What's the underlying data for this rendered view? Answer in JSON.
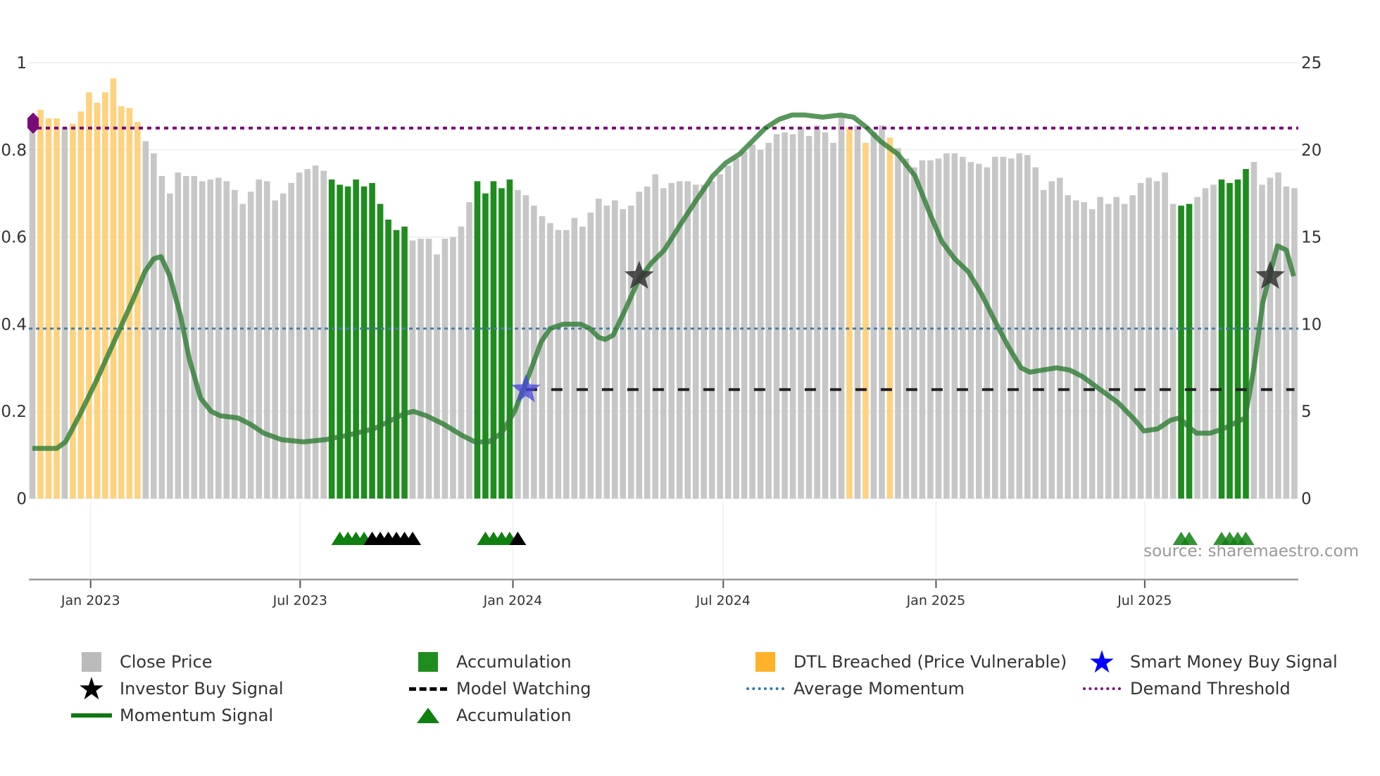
{
  "chart_data": {
    "type": "bar",
    "x_unit": "week index",
    "left_axis": {
      "ylim": [
        0,
        1
      ],
      "ticks": [
        "0",
        "0.2",
        "0.4",
        "0.6",
        "0.8",
        "1"
      ],
      "tick_values": [
        0,
        0.2,
        0.4,
        0.6,
        0.8,
        1
      ]
    },
    "right_axis": {
      "ylim": [
        0,
        25
      ],
      "ticks": [
        "0",
        "5",
        "10",
        "15",
        "20",
        "25"
      ],
      "tick_values": [
        0,
        5,
        10,
        15,
        20,
        25
      ]
    },
    "x_ticks": [
      {
        "label": "Jan 2023",
        "week": 7.2
      },
      {
        "label": "Jul 2023",
        "week": 33.1
      },
      {
        "label": "Jan 2024",
        "week": 59.4
      },
      {
        "label": "Jul 2024",
        "week": 85.4
      },
      {
        "label": "Jan 2025",
        "week": 111.7
      },
      {
        "label": "Jul 2025",
        "week": 137.5
      }
    ],
    "close_price": [
      21.2,
      22.3,
      21.8,
      21.8,
      21.3,
      21.5,
      22.2,
      23.3,
      22.7,
      23.3,
      24.1,
      22.5,
      22.4,
      21.6,
      20.5,
      19.8,
      18.5,
      17.5,
      18.7,
      18.5,
      18.5,
      18.2,
      18.3,
      18.4,
      18.2,
      17.7,
      16.9,
      17.6,
      18.3,
      18.2,
      17.1,
      17.5,
      18.1,
      18.7,
      18.9,
      19.1,
      18.8,
      18.3,
      18.0,
      17.9,
      18.3,
      17.9,
      18.1,
      16.9,
      16.0,
      15.4,
      15.6,
      14.8,
      14.9,
      14.9,
      14.0,
      14.9,
      15.0,
      15.6,
      17.0,
      18.2,
      17.5,
      18.2,
      17.8,
      18.3,
      17.7,
      17.4,
      16.8,
      16.2,
      15.8,
      15.4,
      15.4,
      16.1,
      15.6,
      16.4,
      17.2,
      16.8,
      17.1,
      16.6,
      16.8,
      17.6,
      17.9,
      18.6,
      17.8,
      18.1,
      18.2,
      18.2,
      18.0,
      18.0,
      18.2,
      18.6,
      19.1,
      19.5,
      19.9,
      20.3,
      20.0,
      20.4,
      20.9,
      21.0,
      20.9,
      21.3,
      20.8,
      21.4,
      21.0,
      20.4,
      21.9,
      21.3,
      21.4,
      20.4,
      21.0,
      21.4,
      20.7,
      20.1,
      19.5,
      19.0,
      19.4,
      19.4,
      19.5,
      19.8,
      19.8,
      19.6,
      19.3,
      19.2,
      19.0,
      19.6,
      19.6,
      19.5,
      19.8,
      19.7,
      19.0,
      17.7,
      18.2,
      18.4,
      17.4,
      17.1,
      17.0,
      16.6,
      17.3,
      16.9,
      17.3,
      16.9,
      17.4,
      18.1,
      18.4,
      18.2,
      18.7,
      16.9,
      16.8,
      16.9,
      17.3,
      17.8,
      18.0,
      18.3,
      18.1,
      18.3,
      18.9,
      19.3,
      18.0,
      18.4,
      18.7,
      17.9,
      17.8
    ],
    "bar_state": "GOOOGOOOOOOOOOGGGGGGGGGGGGGGGGGGGGGGGAAAAAAAAAAGGGGGGGGAAAAAGGGGGGGGGGGGGGGGGGGGGGGGGGGGGGGGGGGGGGGGGOGOGGOGGGGGGGGGGGGGGGGGGGGGGGGGGGGGGGGGGGAAGGGAAAAGGGGGGG",
    "momentum_signal": [
      [
        0,
        0.115
      ],
      [
        3,
        0.115
      ],
      [
        4.1,
        0.13
      ],
      [
        5.8,
        0.19
      ],
      [
        7.9,
        0.27
      ],
      [
        10.1,
        0.36
      ],
      [
        12.3,
        0.45
      ],
      [
        13.9,
        0.52
      ],
      [
        15,
        0.55
      ],
      [
        15.9,
        0.555
      ],
      [
        17,
        0.51
      ],
      [
        18.3,
        0.42
      ],
      [
        19.4,
        0.32
      ],
      [
        20.8,
        0.23
      ],
      [
        22.1,
        0.2
      ],
      [
        23.2,
        0.19
      ],
      [
        25.4,
        0.185
      ],
      [
        27,
        0.17
      ],
      [
        28.6,
        0.15
      ],
      [
        30.8,
        0.135
      ],
      [
        33.5,
        0.13
      ],
      [
        36.2,
        0.135
      ],
      [
        38.9,
        0.145
      ],
      [
        42.2,
        0.16
      ],
      [
        44.4,
        0.18
      ],
      [
        46,
        0.195
      ],
      [
        47.1,
        0.2
      ],
      [
        48.7,
        0.19
      ],
      [
        50.9,
        0.17
      ],
      [
        53.1,
        0.145
      ],
      [
        54.7,
        0.13
      ],
      [
        56.4,
        0.13
      ],
      [
        58,
        0.15
      ],
      [
        59.6,
        0.2
      ],
      [
        61.3,
        0.28
      ],
      [
        62.9,
        0.36
      ],
      [
        64,
        0.39
      ],
      [
        65.6,
        0.4
      ],
      [
        67.8,
        0.4
      ],
      [
        68.9,
        0.39
      ],
      [
        70,
        0.37
      ],
      [
        70.8,
        0.365
      ],
      [
        71.8,
        0.375
      ],
      [
        73.2,
        0.43
      ],
      [
        74.9,
        0.5
      ],
      [
        76.5,
        0.54
      ],
      [
        78.1,
        0.57
      ],
      [
        79.8,
        0.62
      ],
      [
        81.9,
        0.68
      ],
      [
        84.1,
        0.74
      ],
      [
        85.7,
        0.77
      ],
      [
        87.4,
        0.79
      ],
      [
        89,
        0.82
      ],
      [
        90.6,
        0.85
      ],
      [
        92.3,
        0.87
      ],
      [
        93.9,
        0.88
      ],
      [
        95.5,
        0.88
      ],
      [
        97.7,
        0.875
      ],
      [
        99.9,
        0.88
      ],
      [
        101.5,
        0.875
      ],
      [
        103.2,
        0.85
      ],
      [
        104.8,
        0.82
      ],
      [
        107,
        0.79
      ],
      [
        109.1,
        0.74
      ],
      [
        110.8,
        0.66
      ],
      [
        112.4,
        0.59
      ],
      [
        114,
        0.55
      ],
      [
        115.7,
        0.52
      ],
      [
        117.3,
        0.47
      ],
      [
        118.9,
        0.41
      ],
      [
        120.6,
        0.35
      ],
      [
        122.2,
        0.3
      ],
      [
        123.3,
        0.29
      ],
      [
        124.9,
        0.295
      ],
      [
        126.6,
        0.3
      ],
      [
        128.2,
        0.295
      ],
      [
        129.8,
        0.28
      ],
      [
        132,
        0.25
      ],
      [
        134.2,
        0.22
      ],
      [
        136.3,
        0.18
      ],
      [
        137.4,
        0.155
      ],
      [
        139.1,
        0.16
      ],
      [
        140.7,
        0.18
      ],
      [
        141.8,
        0.185
      ],
      [
        142.9,
        0.165
      ],
      [
        143.9,
        0.15
      ],
      [
        145.6,
        0.15
      ],
      [
        147.2,
        0.16
      ],
      [
        148.8,
        0.175
      ],
      [
        149.9,
        0.185
      ],
      [
        151,
        0.3
      ],
      [
        152.1,
        0.45
      ],
      [
        153.2,
        0.53
      ],
      [
        153.9,
        0.58
      ],
      [
        155,
        0.57
      ],
      [
        155.9,
        0.51
      ]
    ],
    "average_momentum": 0.39,
    "demand_threshold": 0.85,
    "model_watching": {
      "value": 0.25,
      "from_week": 61,
      "to_week": 156
    },
    "smart_money_buy": [
      [
        61,
        0.25
      ]
    ],
    "investor_buy": [
      [
        75,
        0.51
      ],
      [
        153,
        0.51
      ]
    ],
    "accumulation_markers": {
      "green": [
        38,
        39,
        40,
        41,
        56,
        57,
        58,
        59,
        142,
        143,
        147,
        148,
        149,
        150
      ],
      "black": [
        42,
        43,
        44,
        45,
        46,
        47,
        60
      ]
    },
    "colors": {
      "close": "#c4c4c4",
      "accumulation": "#1e8c1e",
      "dtl": "#ffb833",
      "momentum": "#1a7a1a",
      "avg": "#4a7fa8",
      "threshold": "#7a0a7a",
      "smart": "#0000ff"
    },
    "legend": [
      {
        "label": "Close Price",
        "icon": "gray-square"
      },
      {
        "label": "Accumulation",
        "icon": "green-square"
      },
      {
        "label": "DTL Breached (Price Vulnerable)",
        "icon": "orange-square"
      },
      {
        "label": "Smart Money Buy Signal",
        "icon": "blue-star"
      },
      {
        "label": "Investor Buy Signal",
        "icon": "black-star"
      },
      {
        "label": "Model Watching",
        "icon": "black-dash"
      },
      {
        "label": "Average Momentum",
        "icon": "blue-dots"
      },
      {
        "label": "Demand Threshold",
        "icon": "purple-dots"
      },
      {
        "label": "Momentum Signal",
        "icon": "green-line"
      },
      {
        "label": "Accumulation",
        "icon": "green-triangle"
      }
    ],
    "source": "source: sharemaestro.com"
  }
}
